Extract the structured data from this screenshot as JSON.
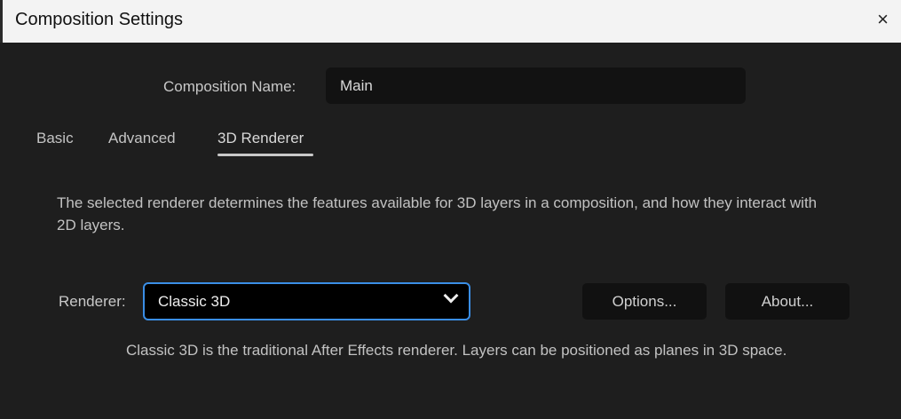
{
  "window": {
    "title": "Composition Settings",
    "close_icon": "×"
  },
  "composition_name": {
    "label": "Composition Name:",
    "value": "Main"
  },
  "tabs": [
    {
      "label": "Basic"
    },
    {
      "label": "Advanced"
    },
    {
      "label": "3D Renderer",
      "active": true
    }
  ],
  "description": "The selected renderer determines the features available for 3D layers in a composition, and how they interact with 2D layers.",
  "renderer": {
    "label": "Renderer:",
    "value": "Classic 3D"
  },
  "buttons": {
    "options": "Options...",
    "about": "About..."
  },
  "renderer_note": "Classic 3D is the traditional After Effects renderer. Layers can be positioned as planes in 3D space.",
  "colors": {
    "accent": "#3a8ee6",
    "background": "#1e1e1e",
    "titlebar": "#f3f3f3"
  }
}
